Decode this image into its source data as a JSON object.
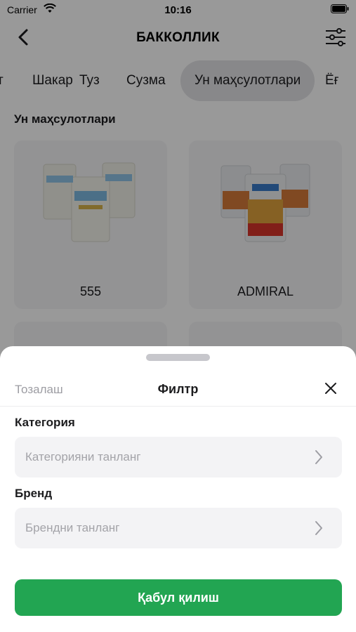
{
  "status_bar": {
    "carrier": "Carrier",
    "time": "10:16"
  },
  "nav": {
    "title": "БАККОЛЛИК"
  },
  "tabs": [
    {
      "label": "т"
    },
    {
      "label": "Шакар"
    },
    {
      "label": "Туз"
    },
    {
      "label": "Сузма"
    },
    {
      "label": "Ун маҳсулотлари",
      "active": true
    },
    {
      "label": "Ёғ"
    }
  ],
  "section": {
    "title": "Ун маҳсулотлари"
  },
  "products": [
    {
      "name": "555"
    },
    {
      "name": "ADMIRAL"
    }
  ],
  "filter_sheet": {
    "clear_label": "Тозалаш",
    "title": "Филтр",
    "category": {
      "label": "Категория",
      "placeholder": "Категорияни танланг"
    },
    "brand": {
      "label": "Бренд",
      "placeholder": "Брендни танланг"
    },
    "apply_label": "Қабул қилиш"
  },
  "colors": {
    "accent": "#22a552",
    "overlay": "#000000"
  }
}
